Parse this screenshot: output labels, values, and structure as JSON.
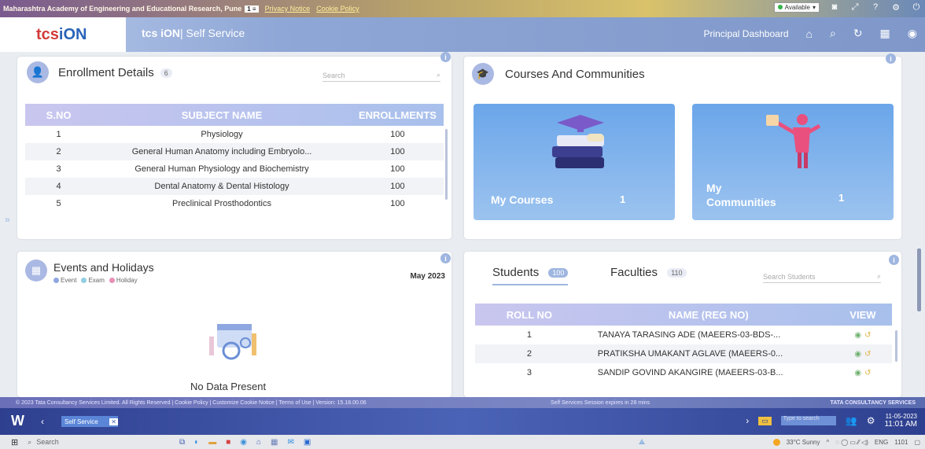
{
  "topbar": {
    "org": "Maharashtra Academy of Engineering and Educational Research, Pune",
    "privacy": "Privacy Notice",
    "cookie": "Cookie Policy",
    "availability": "Available"
  },
  "header": {
    "logo_tc": "tcs",
    "logo_ion": "iON",
    "product_tc": "tcs iON",
    "product_name": "| Self Service",
    "dashboard": "Principal Dashboard"
  },
  "enrollment": {
    "title": "Enrollment Details",
    "count": "6",
    "search_placeholder": "Search",
    "columns": [
      "S.NO",
      "SUBJECT NAME",
      "ENROLLMENTS"
    ],
    "rows": [
      [
        "1",
        "Physiology",
        "100"
      ],
      [
        "2",
        "General Human Anatomy including Embryolo...",
        "100"
      ],
      [
        "3",
        "General Human Physiology and Biochemistry",
        "100"
      ],
      [
        "4",
        "Dental Anatomy & Dental Histology",
        "100"
      ],
      [
        "5",
        "Preclinical Prosthodontics",
        "100"
      ]
    ]
  },
  "courses": {
    "title": "Courses And Communities",
    "tiles": [
      {
        "label": "My Courses",
        "count": "1"
      },
      {
        "label": "My Communities",
        "count": "1"
      }
    ]
  },
  "events": {
    "title": "Events and Holidays",
    "month": "May 2023",
    "legend": [
      "Event",
      "Exam",
      "Holiday"
    ],
    "legend_colors": [
      "#8fa7e0",
      "#8fcfe0",
      "#e78fb5"
    ],
    "empty": "No Data Present"
  },
  "people": {
    "tab_students": "Students",
    "students_count": "100",
    "tab_faculties": "Faculties",
    "faculties_count": "110",
    "search_placeholder": "Search Students",
    "columns": [
      "ROLL NO",
      "NAME (REG NO)",
      "VIEW"
    ],
    "rows": [
      [
        "1",
        "TANAYA TARASING ADE (MAEERS-03-BDS-..."
      ],
      [
        "2",
        "PRATIKSHA UMAKANT AGLAVE (MAEERS-0..."
      ],
      [
        "3",
        "SANDIP GOVIND AKANGIRE (MAEERS-03-B..."
      ]
    ]
  },
  "footer": {
    "left": "© 2023 Tata Consultancy Services Limited. All Rights Reserved | Cookie Policy | Customize Cookie Notice | Terms of Use | Version: 15.18.00.06",
    "mid": "Self Services Session expires in 28 mins",
    "right": "TATA CONSULTANCY SERVICES"
  },
  "citrix": {
    "tab": "Self Service",
    "search": "Type to search",
    "date": "11-05-2023",
    "time": "11:01 AM"
  },
  "taskbar": {
    "search": "Search",
    "weather": "33°C Sunny",
    "lang": "ENG",
    "clock": "1101"
  }
}
